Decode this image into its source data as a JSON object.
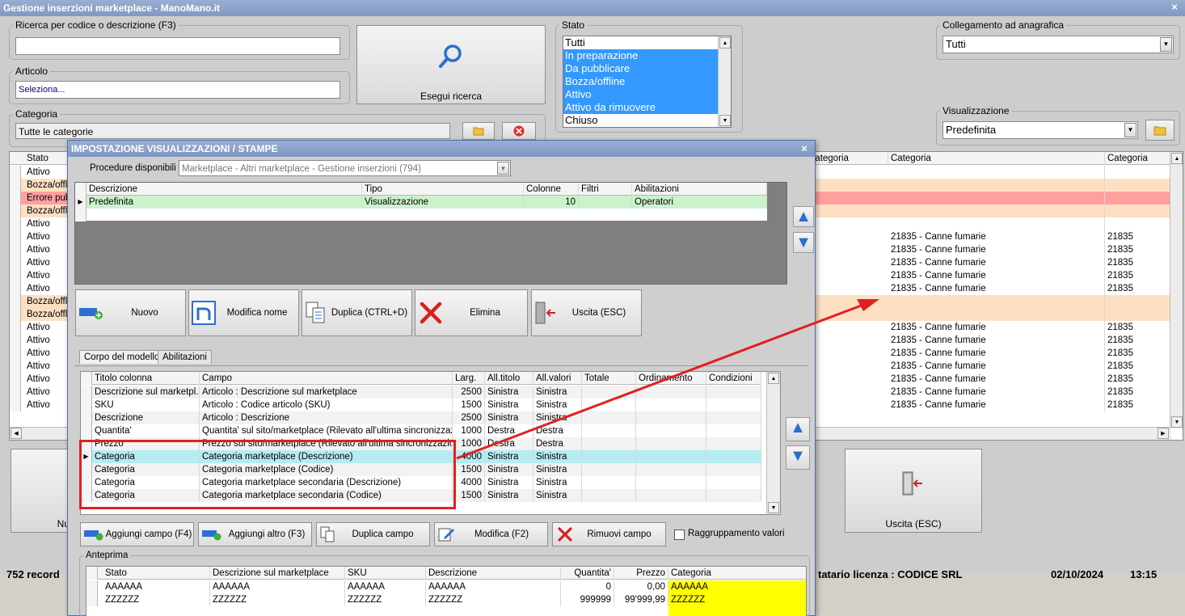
{
  "window": {
    "title": "Gestione inserzioni marketplace - ManoMano.it",
    "close": "×"
  },
  "search": {
    "label": "Ricerca per codice o descrizione (F3)",
    "value": ""
  },
  "articolo": {
    "label": "Articolo",
    "value": "Seleziona..."
  },
  "search_button": {
    "label": "Esegui ricerca"
  },
  "categoria": {
    "label": "Categoria",
    "value": "Tutte le categorie"
  },
  "stato": {
    "label": "Stato",
    "items": [
      "Tutti",
      "In preparazione",
      "Da pubblicare",
      "Bozza/offline",
      "Attivo",
      "Attivo da rimuovere",
      "Chiuso"
    ]
  },
  "collegamento": {
    "label": "Collegamento ad anagrafica",
    "value": "Tutti"
  },
  "visualizzazione": {
    "label": "Visualizzazione",
    "value": "Predefinita"
  },
  "main_grid": {
    "headers": [
      "Stato",
      "Categoria",
      "Categoria",
      "Categoria"
    ],
    "rows": [
      {
        "stato": "Attivo",
        "cat": "",
        "cat2": "",
        "tone": "w"
      },
      {
        "stato": "Bozza/offline",
        "cat": "",
        "cat2": "",
        "tone": "o"
      },
      {
        "stato": "Errore pubblicazione",
        "cat": "",
        "cat2": "",
        "tone": "r"
      },
      {
        "stato": "Bozza/offline",
        "cat": "",
        "cat2": "",
        "tone": "o"
      },
      {
        "stato": "Attivo",
        "cat": "",
        "cat2": "",
        "tone": "w"
      },
      {
        "stato": "Attivo",
        "cat": "21835 - Canne fumarie",
        "cat2": "21835",
        "tone": "w"
      },
      {
        "stato": "Attivo",
        "cat": "21835 - Canne fumarie",
        "cat2": "21835",
        "tone": "w"
      },
      {
        "stato": "Attivo",
        "cat": "21835 - Canne fumarie",
        "cat2": "21835",
        "tone": "w"
      },
      {
        "stato": "Attivo",
        "cat": "21835 - Canne fumarie",
        "cat2": "21835",
        "tone": "w"
      },
      {
        "stato": "Attivo",
        "cat": "21835 - Canne fumarie",
        "cat2": "21835",
        "tone": "w"
      },
      {
        "stato": "Bozza/offline",
        "cat": "",
        "cat2": "",
        "tone": "o"
      },
      {
        "stato": "Bozza/offline",
        "cat": "",
        "cat2": "",
        "tone": "o"
      },
      {
        "stato": "Attivo",
        "cat": "21835 - Canne fumarie",
        "cat2": "21835",
        "tone": "w"
      },
      {
        "stato": "Attivo",
        "cat": "21835 - Canne fumarie",
        "cat2": "21835",
        "tone": "w"
      },
      {
        "stato": "Attivo",
        "cat": "21835 - Canne fumarie",
        "cat2": "21835",
        "tone": "w"
      },
      {
        "stato": "Attivo",
        "cat": "21835 - Canne fumarie",
        "cat2": "21835",
        "tone": "w"
      },
      {
        "stato": "Attivo",
        "cat": "21835 - Canne fumarie",
        "cat2": "21835",
        "tone": "w"
      },
      {
        "stato": "Attivo",
        "cat": "21835 - Canne fumarie",
        "cat2": "21835",
        "tone": "w"
      },
      {
        "stato": "Attivo",
        "cat": "21835 - Canne fumarie",
        "cat2": "21835",
        "tone": "w"
      }
    ]
  },
  "bottom_buttons": {
    "nuovo": "Nu",
    "uscita": "Uscita (ESC)"
  },
  "statusbar": {
    "records": "752 record",
    "license": "tatario licenza : CODICE SRL",
    "date": "02/10/2024",
    "time": "13:15"
  },
  "dialog": {
    "title": "IMPOSTAZIONE VISUALIZZAZIONI / STAMPE",
    "close": "×",
    "procedure_label": "Procedure disponibili :",
    "procedure_value": "Marketplace - Altri marketplace - Gestione inserzioni (794)",
    "views_headers": [
      "Descrizione",
      "Tipo",
      "Colonne",
      "Filtri",
      "Abilitazioni"
    ],
    "views_rows": [
      {
        "descrizione": "Predefinita",
        "tipo": "Visualizzazione",
        "colonne": "10",
        "filtri": "",
        "abilitazioni": "Operatori"
      }
    ],
    "buttons": {
      "nuovo": "Nuovo",
      "modifica": "Modifica nome",
      "duplica": "Duplica (CTRL+D)",
      "elimina": "Elimina",
      "uscita": "Uscita (ESC)"
    },
    "tabs": [
      "Corpo del modello",
      "Abilitazioni"
    ],
    "fields_headers": [
      "Titolo colonna",
      "Campo",
      "Larg.",
      "All.titolo",
      "All.valori",
      "Totale",
      "Ordinamento",
      "Condizioni"
    ],
    "fields_rows": [
      [
        "Descrizione sul marketpl...",
        "Articolo : Descrizione sul marketplace",
        "2500",
        "Sinistra",
        "Sinistra"
      ],
      [
        "SKU",
        "Articolo : Codice articolo (SKU)",
        "1500",
        "Sinistra",
        "Sinistra"
      ],
      [
        "Descrizione",
        "Articolo : Descrizione",
        "2500",
        "Sinistra",
        "Sinistra"
      ],
      [
        "Quantita'",
        "Quantita' sul sito/marketplace (Rilevato all'ultima sincronizzazi...",
        "1000",
        "Destra",
        "Destra"
      ],
      [
        "Prezzo",
        "Prezzo sul sito/marketplace (Rilevato all'ultima sincronizzazione)",
        "1000",
        "Destra",
        "Destra"
      ],
      [
        "Categoria",
        "Categoria marketplace (Descrizione)",
        "4000",
        "Sinistra",
        "Sinistra"
      ],
      [
        "Categoria",
        "Categoria marketplace (Codice)",
        "1500",
        "Sinistra",
        "Sinistra"
      ],
      [
        "Categoria",
        "Categoria marketplace secondaria (Descrizione)",
        "4000",
        "Sinistra",
        "Sinistra"
      ],
      [
        "Categoria",
        "Categoria marketplace secondaria (Codice)",
        "1500",
        "Sinistra",
        "Sinistra"
      ]
    ],
    "field_buttons": {
      "aggiungi_campo": "Aggiungi campo (F4)",
      "aggiungi_altro": "Aggiungi altro (F3)",
      "duplica_campo": "Duplica campo",
      "modifica": "Modifica (F2)",
      "rimuovi": "Rimuovi campo"
    },
    "raggruppamento": "Raggruppamento valori",
    "preview_label": "Anteprima",
    "preview_headers": [
      "Stato",
      "Descrizione sul marketplace",
      "SKU",
      "Descrizione",
      "Quantita'",
      "Prezzo",
      "Categoria"
    ],
    "preview_rows": [
      [
        "AAAAAA",
        "AAAAAA",
        "AAAAAA",
        "AAAAAA",
        "0",
        "0,00",
        "AAAAAA"
      ],
      [
        "ZZZZZZ",
        "ZZZZZZ",
        "ZZZZZZ",
        "ZZZZZZ",
        "999999",
        "99'999,99",
        "ZZZZZZ"
      ]
    ]
  },
  "colors": {
    "orange_row": "#fde0c2",
    "red_row": "#ff9f9f",
    "cyan_row": "#b4ecf2",
    "green_row": "#ccf2cc",
    "yellow": "#ffff00",
    "highlight_red": "#e02020"
  }
}
